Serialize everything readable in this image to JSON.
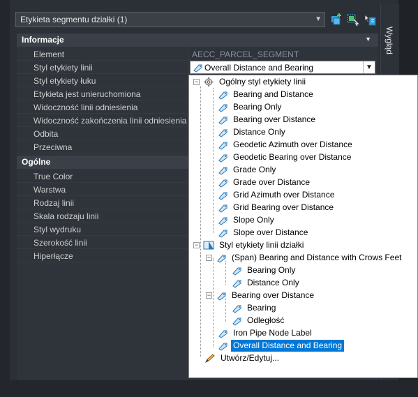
{
  "header": {
    "selector_value": "Etykieta segmentu działki (1)"
  },
  "side_tab": {
    "label": "Wygląd"
  },
  "categories": {
    "informacje": "Informacje",
    "ogolne": "Ogólne"
  },
  "info_rows": [
    {
      "name": "Element",
      "value": "AECC_PARCEL_SEGMENT"
    },
    {
      "name": "Styl etykiety linii",
      "value": ""
    },
    {
      "name": "Styl etykiety łuku",
      "value": ""
    },
    {
      "name": "Etykieta jest unieruchomiona",
      "value": ""
    },
    {
      "name": "Widoczność linii odniesienia",
      "value": ""
    },
    {
      "name": "Widoczność zakończenia linii odniesienia",
      "value": ""
    },
    {
      "name": "Odbita",
      "value": ""
    },
    {
      "name": "Przeciwna",
      "value": ""
    }
  ],
  "general_rows": [
    {
      "name": "True Color"
    },
    {
      "name": "Warstwa"
    },
    {
      "name": "Rodzaj linii"
    },
    {
      "name": "Skala rodzaju linii"
    },
    {
      "name": "Styl wydruku"
    },
    {
      "name": "Szerokość linii"
    },
    {
      "name": "Hiperłącze"
    }
  ],
  "combo": {
    "value": "Overall Distance and Bearing"
  },
  "tree": {
    "group1": {
      "label": "Ogólny styl etykiety linii",
      "items": [
        "Bearing and Distance",
        "Bearing Only",
        "Bearing over Distance",
        "Distance Only",
        "Geodetic Azimuth over Distance",
        "Geodetic Bearing over Distance",
        "Grade Only",
        "Grade over Distance",
        "Grid Azimuth over Distance",
        "Grid Bearing over Distance",
        "Slope Only",
        "Slope over Distance"
      ]
    },
    "group2": {
      "label": "Styl etykiety linii działki",
      "span": {
        "label": "(Span)  Bearing and Distance with Crows Feet",
        "items": [
          "Bearing Only",
          "Distance Only"
        ]
      },
      "bod": {
        "label": "Bearing over Distance",
        "items": [
          "Bearing",
          "Odległość"
        ]
      },
      "iron": "Iron Pipe Node Label",
      "overall": "Overall Distance and Bearing"
    },
    "create_edit": "Utwórz/Edytuj..."
  },
  "colors": {
    "selection": "#0078d7",
    "panel_bg": "#2f333a",
    "category_bg": "#3b4048"
  }
}
